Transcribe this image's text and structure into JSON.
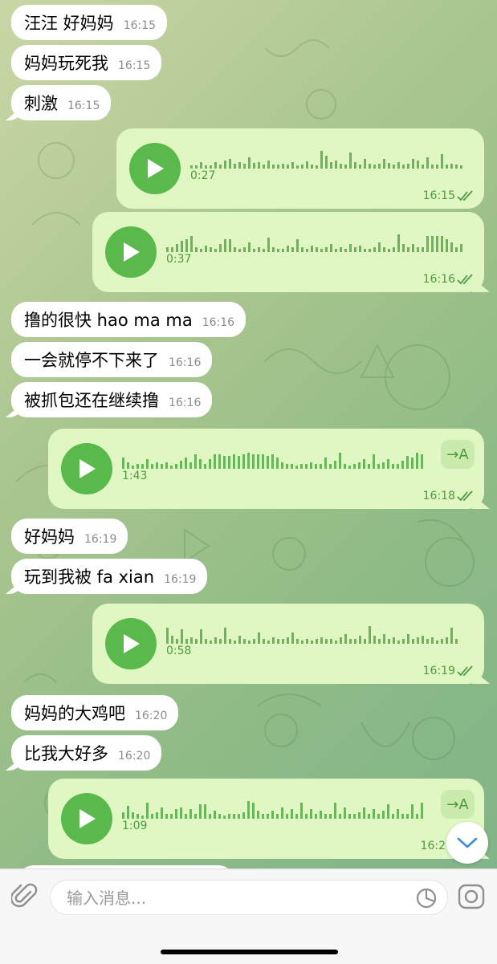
{
  "messages_in": [
    {
      "text": "汪汪 好妈妈",
      "time": "16:15"
    },
    {
      "text": "妈妈玩死我",
      "time": "16:15"
    },
    {
      "text": "刺激",
      "time": "16:15"
    },
    {
      "text": "撸的很快 hao ma ma",
      "time": "16:16"
    },
    {
      "text": "一会就停不下来了",
      "time": "16:16"
    },
    {
      "text": "被抓包还在继续撸",
      "time": "16:16"
    },
    {
      "text": "好妈妈",
      "time": "16:19"
    },
    {
      "text": "玩到我被 fa xian",
      "time": "16:19"
    },
    {
      "text": "妈妈的大鸡吧",
      "time": "16:20"
    },
    {
      "text": "比我大好多",
      "time": "16:20"
    }
  ],
  "voice_out": [
    {
      "duration": "0:27",
      "time": "16:15",
      "status": "read",
      "transcribe": false
    },
    {
      "duration": "0:37",
      "time": "16:16",
      "status": "read",
      "transcribe": false
    },
    {
      "duration": "1:43",
      "time": "16:18",
      "status": "read",
      "transcribe": true,
      "transcribe_label": "→A"
    },
    {
      "duration": "0:58",
      "time": "16:19",
      "status": "read",
      "transcribe": false
    },
    {
      "duration": "1:09",
      "time": "16:2",
      "status": "read",
      "transcribe": true,
      "transcribe_label": "→A"
    }
  ],
  "input": {
    "placeholder": "输入消息..."
  },
  "colors": {
    "outgoing_bubble": "#e0f7c4",
    "play_button": "#59b94a",
    "accent_text": "#4d9a3e",
    "incoming_bubble": "#ffffff"
  },
  "icons": [
    "play-icon",
    "double-check-icon",
    "transcribe-icon",
    "chevron-down-icon",
    "paperclip-icon",
    "sticker-icon",
    "camera-icon"
  ]
}
